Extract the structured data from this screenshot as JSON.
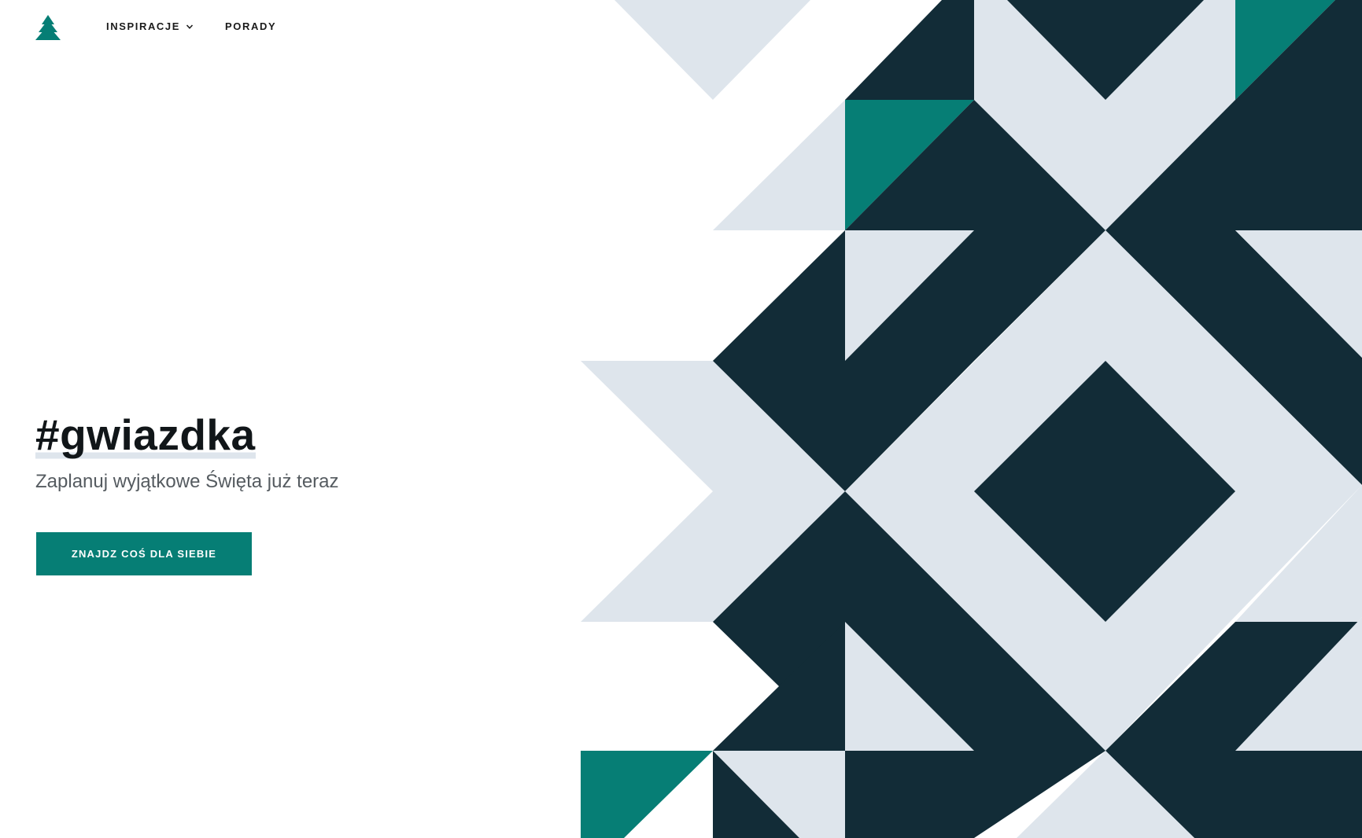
{
  "colors": {
    "navy": "#122c37",
    "light": "#dee5ec",
    "teal": "#067e75",
    "background": "#ffffff",
    "title": "#111619",
    "subtitle": "#555b60"
  },
  "header": {
    "logo_icon": "christmas-tree-icon",
    "nav": [
      {
        "label": "INSPIRACJE",
        "has_dropdown": true,
        "icon": "chevron-down-icon"
      },
      {
        "label": "PORADY",
        "has_dropdown": false
      }
    ]
  },
  "hero": {
    "title": "#gwiazdka",
    "subtitle": "Zaplanuj wyjątkowe Święta już teraz",
    "cta_label": "ZNAJDZ COŚ DLA SIEBIE"
  },
  "decor": {
    "name": "geometric-pattern"
  }
}
